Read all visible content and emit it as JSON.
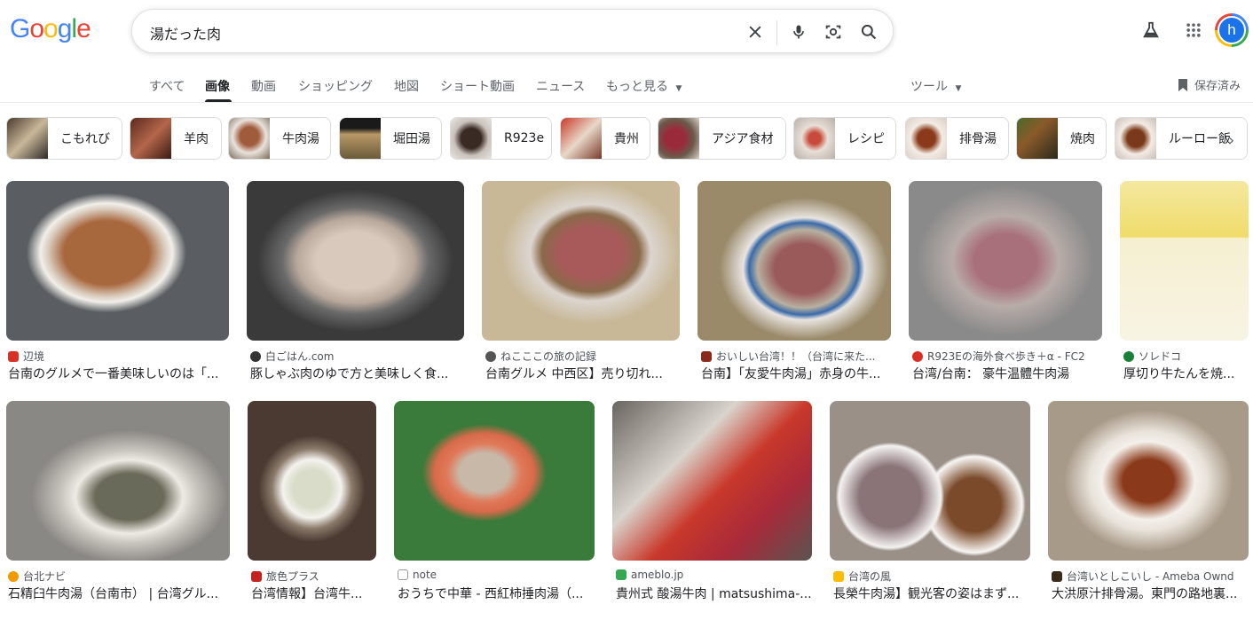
{
  "logo": "Google",
  "search": {
    "query": "湯だった肉"
  },
  "tabs": [
    "すべて",
    "画像",
    "動画",
    "ショッピング",
    "地図",
    "ショート動画",
    "ニュース",
    "もっと見る"
  ],
  "tools": "ツール",
  "saved": "保存済み",
  "avatar_letter": "h",
  "chips": [
    "こもれび",
    "羊肉",
    "牛肉湯",
    "堀田湯",
    "R923e",
    "貴州",
    "アジア食材",
    "レシピ",
    "排骨湯",
    "焼肉",
    "ルーロー飯"
  ],
  "results": [
    {
      "source": "辺境",
      "caption": "台南のグルメで一番美味しいのは「..."
    },
    {
      "source": "白ごはん.com",
      "caption": "豚しゃぶ肉のゆで方と美味しく食..."
    },
    {
      "source": "ねこここの旅の記録",
      "caption": "台南グルメ 中西区】売り切れ..."
    },
    {
      "source": "おいしい台湾！！（台湾に来た...",
      "caption": "台南】「友愛牛肉湯」赤身の牛..."
    },
    {
      "source": "R923Eの海外食べ歩き＋α - FC2",
      "caption": "台湾/台南： 豪牛温體牛肉湯"
    },
    {
      "source": "ソレドコ",
      "caption": "厚切り牛たんを焼..."
    },
    {
      "source": "台北ナビ",
      "caption": "石精臼牛肉湯（台南市） | 台湾グル..."
    },
    {
      "source": "旅色プラス",
      "caption": "台湾情報】台湾牛..."
    },
    {
      "source": "note",
      "caption": "おうちで中華 - 西紅柿捶肉湯（..."
    },
    {
      "source": "ameblo.jp",
      "caption": "貴州式 酸湯牛肉 | matsushima-..."
    },
    {
      "source": "台湾の風",
      "caption": "長榮牛肉湯】観光客の姿はまず..."
    },
    {
      "source": "台湾いとしこいし - Ameba Ownd",
      "caption": "大洪原汁排骨湯。東門の路地裏..."
    }
  ],
  "colors": {
    "blue": "#4285f4",
    "red": "#ea4335",
    "yellow": "#fbbc05",
    "green": "#34a853"
  }
}
